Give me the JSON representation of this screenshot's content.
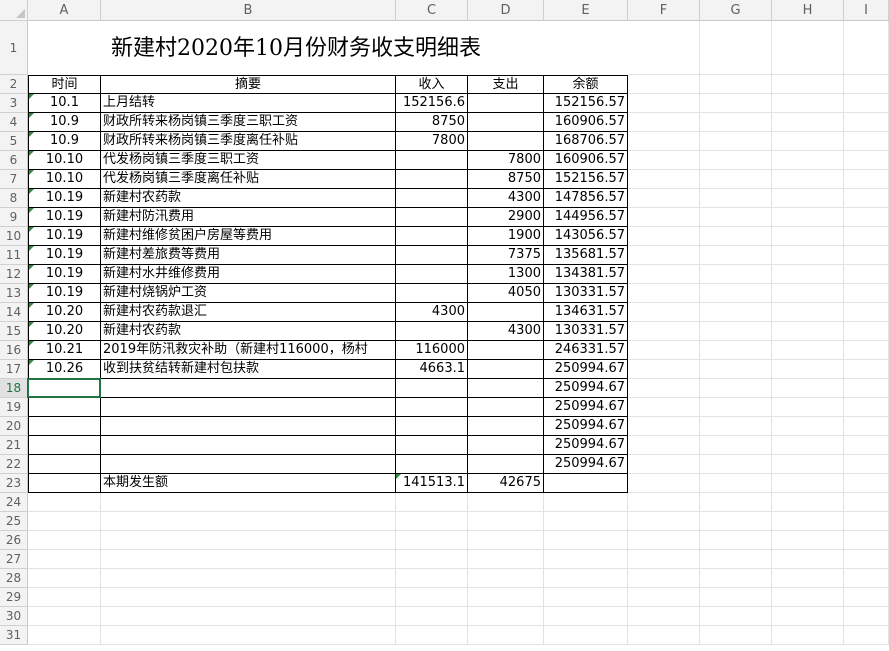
{
  "columns": [
    "A",
    "B",
    "C",
    "D",
    "E",
    "F",
    "G",
    "H",
    "I"
  ],
  "title": "新建村2020年10月份财务收支明细表",
  "header": {
    "date": "时间",
    "summary": "摘要",
    "income": "收入",
    "expense": "支出",
    "balance": "余额"
  },
  "rows": [
    {
      "date": "10.1",
      "summary": "上月结转",
      "income": "152156.6",
      "expense": "",
      "balance": "152156.57"
    },
    {
      "date": "10.9",
      "summary": "财政所转来杨岗镇三季度三职工资",
      "income": "8750",
      "expense": "",
      "balance": "160906.57"
    },
    {
      "date": "10.9",
      "summary": "财政所转来杨岗镇三季度离任补贴",
      "income": "7800",
      "expense": "",
      "balance": "168706.57"
    },
    {
      "date": "10.10",
      "summary": "代发杨岗镇三季度三职工资",
      "income": "",
      "expense": "7800",
      "balance": "160906.57"
    },
    {
      "date": "10.10",
      "summary": "代发杨岗镇三季度离任补贴",
      "income": "",
      "expense": "8750",
      "balance": "152156.57"
    },
    {
      "date": "10.19",
      "summary": "新建村农药款",
      "income": "",
      "expense": "4300",
      "balance": "147856.57"
    },
    {
      "date": "10.19",
      "summary": "新建村防汛费用",
      "income": "",
      "expense": "2900",
      "balance": "144956.57"
    },
    {
      "date": "10.19",
      "summary": "新建村维修贫困户房屋等费用",
      "income": "",
      "expense": "1900",
      "balance": "143056.57"
    },
    {
      "date": "10.19",
      "summary": "新建村差旅费等费用",
      "income": "",
      "expense": "7375",
      "balance": "135681.57"
    },
    {
      "date": "10.19",
      "summary": "新建村水井维修费用",
      "income": "",
      "expense": "1300",
      "balance": "134381.57"
    },
    {
      "date": "10.19",
      "summary": "新建村烧锅炉工资",
      "income": "",
      "expense": "4050",
      "balance": "130331.57"
    },
    {
      "date": "10.20",
      "summary": "新建村农药款退汇",
      "income": "4300",
      "expense": "",
      "balance": "134631.57"
    },
    {
      "date": "10.20",
      "summary": "新建村农药款",
      "income": "",
      "expense": "4300",
      "balance": "130331.57"
    },
    {
      "date": "10.21",
      "summary": "2019年防汛救灾补助（新建村116000，杨村",
      "income": "116000",
      "expense": "",
      "balance": "246331.57"
    },
    {
      "date": "10.26",
      "summary": "收到扶贫结转新建村包扶款",
      "income": "4663.1",
      "expense": "",
      "balance": "250994.67"
    },
    {
      "date": "",
      "summary": "",
      "income": "",
      "expense": "",
      "balance": "250994.67"
    },
    {
      "date": "",
      "summary": "",
      "income": "",
      "expense": "",
      "balance": "250994.67"
    },
    {
      "date": "",
      "summary": "",
      "income": "",
      "expense": "",
      "balance": "250994.67"
    },
    {
      "date": "",
      "summary": "",
      "income": "",
      "expense": "",
      "balance": "250994.67"
    },
    {
      "date": "",
      "summary": "",
      "income": "",
      "expense": "",
      "balance": "250994.67"
    }
  ],
  "total": {
    "summary": "本期发生额",
    "income": "141513.1",
    "expense": "42675"
  },
  "selected_row": "18"
}
